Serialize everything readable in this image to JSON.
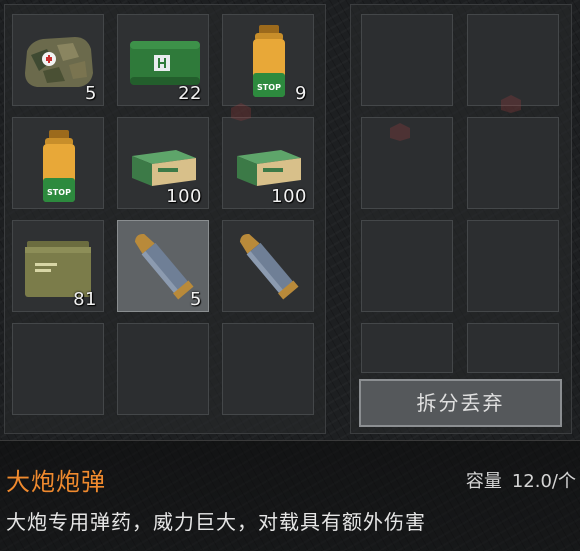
{
  "inventory": {
    "slots": [
      {
        "item": "medkit-bag",
        "qty": "5"
      },
      {
        "item": "bandage-pack",
        "qty": "22"
      },
      {
        "item": "stop-bottle",
        "qty": "9"
      },
      {
        "item": "stop-bottle",
        "qty": ""
      },
      {
        "item": "ammo-box",
        "qty": "100"
      },
      {
        "item": "ammo-box",
        "qty": "100"
      },
      {
        "item": "ammo-can",
        "qty": "81"
      },
      {
        "item": "artillery-shell",
        "qty": "5",
        "selected": true
      },
      {
        "item": "artillery-shell",
        "qty": ""
      },
      {
        "item": "",
        "qty": ""
      },
      {
        "item": "",
        "qty": ""
      },
      {
        "item": "",
        "qty": ""
      }
    ]
  },
  "actions": {
    "split_discard_label": "拆分丢弃"
  },
  "detail": {
    "name": "大炮炮弹",
    "capacity_label": "容量",
    "capacity_value": "12.0/个",
    "description": "大炮专用弹药，威力巨大，对载具有额外伤害"
  },
  "colors": {
    "item_name": "#f08a2e",
    "background": "#1d1f21"
  }
}
